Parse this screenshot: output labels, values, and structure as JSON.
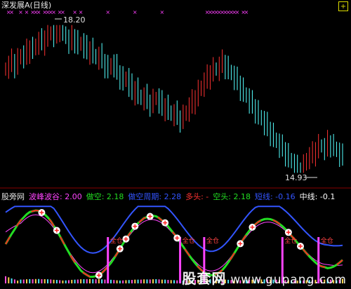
{
  "title": "深发展A(日线)",
  "corner_button": "+",
  "watermark": {
    "zh": "股套网",
    "url": "www.gupang.com"
  },
  "indicator": {
    "name": "股旁网",
    "items": [
      {
        "label": "波峰波谷: 2.00",
        "color": "#ff44ff"
      },
      {
        "label": "做空: 2.18",
        "color": "#22dd22"
      },
      {
        "label": "做空周期: 2.28",
        "color": "#3355ff"
      },
      {
        "label": "多头: -",
        "color": "#ff3333"
      },
      {
        "label": "空头: 2.18",
        "color": "#22dd22"
      },
      {
        "label": "短线: -0.16",
        "color": "#3355ff"
      },
      {
        "label": "中线: -0.1",
        "color": "#ffffff"
      }
    ]
  },
  "position_labels": [
    "全仓",
    "全仓",
    "全仓",
    "全仓",
    "全仓"
  ],
  "chart_data": {
    "type": "candlestick",
    "high_label": "18.20",
    "low_label": "14.93",
    "high": 18.2,
    "low": 14.93,
    "colors": {
      "up": "#ff3232",
      "down": "#54ffff",
      "signal_x": "#ff40ff",
      "pink_line": "#ff44ff",
      "blue_line": "#3355ff",
      "green_line": "#22dd22",
      "red_line": "#ff2222",
      "white_line": "#ffffff"
    },
    "close": [
      17.25,
      17.32,
      17.4,
      17.3,
      17.45,
      17.55,
      17.48,
      17.62,
      17.7,
      17.65,
      17.78,
      17.85,
      17.8,
      17.92,
      17.98,
      18.05,
      17.95,
      18.1,
      18.15,
      18.05,
      17.9,
      17.8,
      17.95,
      17.85,
      17.75,
      17.82,
      17.7,
      17.6,
      17.68,
      17.55,
      17.45,
      17.52,
      17.4,
      17.3,
      17.22,
      17.35,
      17.28,
      17.15,
      17.05,
      16.95,
      17.05,
      16.85,
      16.7,
      16.8,
      16.65,
      16.55,
      16.62,
      16.5,
      16.45,
      16.55,
      16.6,
      16.48,
      16.35,
      16.42,
      16.3,
      16.2,
      16.25,
      16.15,
      16.1,
      16.2,
      16.3,
      16.4,
      16.5,
      16.6,
      16.75,
      16.85,
      16.95,
      17.05,
      17.15,
      17.25,
      17.2,
      17.3,
      17.38,
      17.28,
      17.2,
      17.1,
      17.0,
      16.92,
      16.8,
      16.7,
      16.6,
      16.48,
      16.4,
      16.3,
      16.2,
      16.1,
      16.0,
      15.9,
      15.8,
      15.7,
      15.6,
      15.5,
      15.45,
      15.35,
      15.25,
      15.15,
      15.05,
      15.0,
      14.95,
      15.1,
      15.25,
      15.3,
      15.35,
      15.45,
      15.55,
      15.5,
      15.45,
      15.6,
      15.55,
      15.5,
      15.4,
      15.3,
      15.25
    ],
    "signals": [
      0,
      1,
      1,
      0,
      0,
      1,
      0,
      1,
      0,
      1,
      1,
      1,
      0,
      1,
      1,
      1,
      1,
      0,
      1,
      1,
      0,
      0,
      0,
      1,
      0,
      1,
      0,
      0,
      0,
      0,
      0,
      0,
      0,
      0,
      1,
      0,
      0,
      0,
      0,
      0,
      0,
      0,
      0,
      1,
      0,
      0,
      0,
      0,
      0,
      0,
      0,
      0,
      1,
      0,
      0,
      0,
      0,
      0,
      0,
      0,
      0,
      0,
      0,
      0,
      0,
      0,
      0,
      1,
      1,
      1,
      1,
      1,
      1,
      1,
      1,
      1,
      1,
      1,
      0,
      1,
      1,
      0,
      0,
      0,
      0,
      0,
      0,
      0,
      0,
      0,
      0,
      0,
      0,
      0,
      0,
      0,
      0,
      0,
      0,
      0,
      0,
      0,
      0,
      0,
      0,
      0,
      0,
      0,
      0,
      0,
      0,
      0,
      0
    ]
  }
}
